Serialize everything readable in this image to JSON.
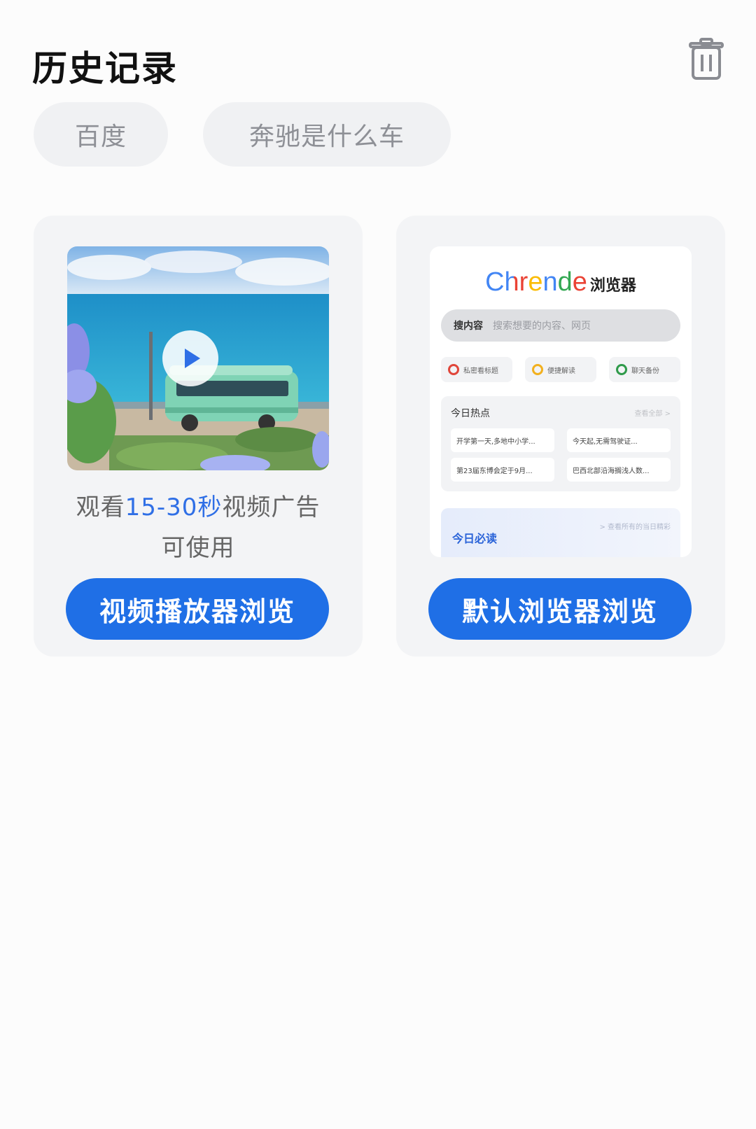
{
  "header": {
    "title": "历史记录",
    "clear_icon": "trash-icon"
  },
  "history_chips": [
    {
      "label": "百度"
    },
    {
      "label": "奔驰是什么车"
    }
  ],
  "video_card": {
    "play_icon": "play-icon",
    "ad_text_prefix": "观看",
    "ad_text_highlight": "15-30秒",
    "ad_text_suffix": "视频广告",
    "ad_text_line2": "可使用",
    "button_label": "视频播放器浏览",
    "accent_color": "#2f6fe6"
  },
  "browser_card": {
    "preview": {
      "logo_text": "Chrende",
      "logo_suffix": "浏览器",
      "search_prefix": "搜内容",
      "search_placeholder": "搜索想要的内容、网页",
      "shortcuts": [
        {
          "label": "私密看标题",
          "color": "#e0463a"
        },
        {
          "label": "便捷解读",
          "color": "#f2b01e"
        },
        {
          "label": "聊天备份",
          "color": "#2f9a4a"
        }
      ],
      "hot_title": "今日热点",
      "hot_more": "查看全部 >",
      "hot_items": [
        "开学第一天,多地中小学...",
        "今天起,无需驾驶证...",
        "第23届东博会定于9月...",
        "巴西北部沿海搁浅人数..."
      ],
      "daily_label": "今日必读",
      "daily_small": "> 查看所有的当日精彩"
    },
    "button_label": "默认浏览器浏览",
    "button_color": "#1f6fe6"
  }
}
